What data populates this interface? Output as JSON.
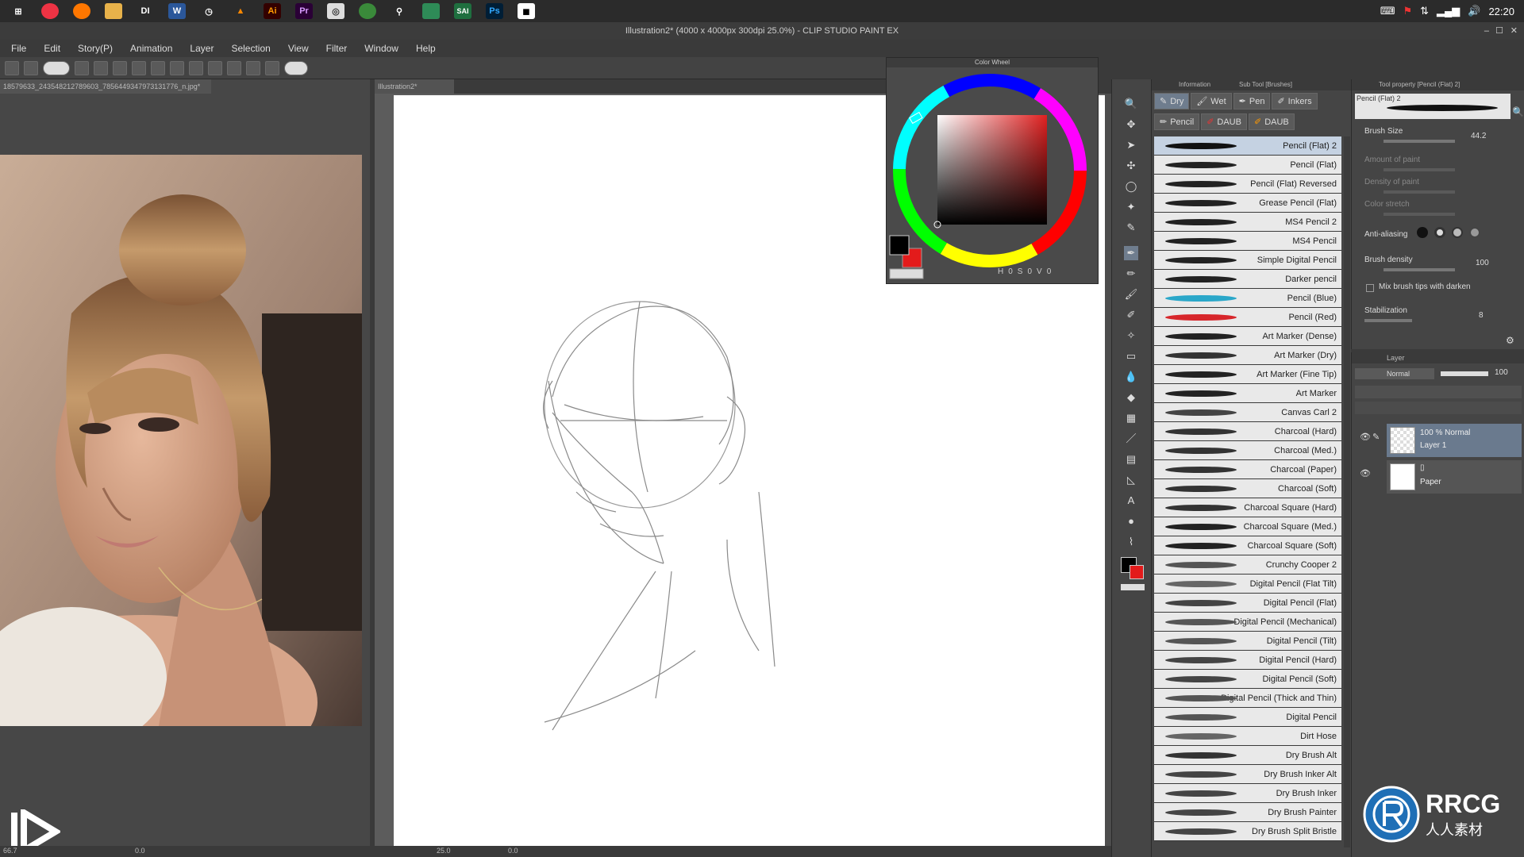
{
  "taskbar": {
    "apps": [
      "DI",
      "W",
      "Ai",
      "Pr",
      "Ps"
    ],
    "clock": "22:20"
  },
  "window": {
    "title": "Illustration2* (4000 x 4000px 300dpi 25.0%)  - CLIP STUDIO PAINT EX"
  },
  "menu": {
    "items": [
      "File",
      "Edit",
      "Story(P)",
      "Animation",
      "Layer",
      "Selection",
      "View",
      "Filter",
      "Window",
      "Help"
    ]
  },
  "reference": {
    "tab_label": "18579633_243548212789603_7856449347973131776_n.jpg*"
  },
  "canvas": {
    "tab_label": "Illustration2*",
    "zoom": "25.0",
    "angle": "0.0",
    "left_zoom": "66.7",
    "left_angle": "0.0"
  },
  "color_wheel": {
    "title": "Color Wheel",
    "h_label": "H",
    "h_value": "0",
    "s_label": "S",
    "s_value": "0",
    "v_label": "V",
    "v_value": "0",
    "main_color": "#000000",
    "sub_color": "#e31b1b"
  },
  "subtool": {
    "title": "Sub Tool [Brushes]",
    "info_tab": "Information",
    "groups": [
      {
        "label": "Dry",
        "active": true
      },
      {
        "label": "Wet",
        "active": false
      },
      {
        "label": "Pen",
        "active": false
      },
      {
        "label": "Inkers",
        "active": false
      }
    ],
    "groups2": [
      {
        "label": "Pencil"
      },
      {
        "label": "DAUB"
      },
      {
        "label": "DAUB"
      }
    ],
    "brushes": [
      {
        "name": "Pencil (Flat) 2",
        "selected": true,
        "color": "#111"
      },
      {
        "name": "Pencil (Flat)",
        "color": "#222"
      },
      {
        "name": "Pencil (Flat) Reversed",
        "color": "#222"
      },
      {
        "name": "Grease Pencil (Flat)",
        "color": "#222"
      },
      {
        "name": "MS4 Pencil 2",
        "color": "#222"
      },
      {
        "name": "MS4 Pencil",
        "color": "#222"
      },
      {
        "name": "Simple Digital Pencil",
        "color": "#222"
      },
      {
        "name": "Darker pencil",
        "color": "#222"
      },
      {
        "name": "Pencil (Blue)",
        "color": "#2aa7c9"
      },
      {
        "name": "Pencil (Red)",
        "color": "#d7262b"
      },
      {
        "name": "Art Marker (Dense)",
        "color": "#222"
      },
      {
        "name": "Art Marker (Dry)",
        "color": "#333"
      },
      {
        "name": "Art Marker (Fine Tip)",
        "color": "#222"
      },
      {
        "name": "Art Marker",
        "color": "#222"
      },
      {
        "name": "Canvas Carl 2",
        "color": "#444"
      },
      {
        "name": "Charcoal (Hard)",
        "color": "#333"
      },
      {
        "name": "Charcoal (Med.)",
        "color": "#333"
      },
      {
        "name": "Charcoal (Paper)",
        "color": "#333"
      },
      {
        "name": "Charcoal (Soft)",
        "color": "#333"
      },
      {
        "name": "Charcoal Square (Hard)",
        "color": "#333"
      },
      {
        "name": "Charcoal Square (Med.)",
        "color": "#222"
      },
      {
        "name": "Charcoal Square (Soft)",
        "color": "#222"
      },
      {
        "name": "Crunchy Cooper 2",
        "color": "#555"
      },
      {
        "name": "Digital Pencil (Flat Tilt)",
        "color": "#666"
      },
      {
        "name": "Digital Pencil (Flat)",
        "color": "#444"
      },
      {
        "name": "Digital Pencil (Mechanical)",
        "color": "#555"
      },
      {
        "name": "Digital Pencil (Tilt)",
        "color": "#555"
      },
      {
        "name": "Digital Pencil (Hard)",
        "color": "#444"
      },
      {
        "name": "Digital Pencil (Soft)",
        "color": "#444"
      },
      {
        "name": "Digital Pencil (Thick and Thin)",
        "color": "#555"
      },
      {
        "name": "Digital Pencil",
        "color": "#555"
      },
      {
        "name": "Dirt Hose",
        "color": "#666"
      },
      {
        "name": "Dry Brush Alt",
        "color": "#333"
      },
      {
        "name": "Dry Brush Inker Alt",
        "color": "#444"
      },
      {
        "name": "Dry Brush Inker",
        "color": "#444"
      },
      {
        "name": "Dry Brush Painter",
        "color": "#444"
      },
      {
        "name": "Dry Brush Split Bristle",
        "color": "#444"
      }
    ]
  },
  "tool_property": {
    "title": "Tool property [Pencil (Flat) 2]",
    "preview_label": "Pencil (Flat) 2",
    "brush_size_label": "Brush Size",
    "brush_size_value": "44.2",
    "amount_of_paint_label": "Amount of paint",
    "density_of_paint_label": "Density of paint",
    "color_stretch_label": "Color stretch",
    "anti_aliasing_label": "Anti-aliasing",
    "brush_density_label": "Brush density",
    "brush_density_value": "100",
    "mix_tips_label": "Mix brush tips with darken",
    "stabilization_label": "Stabilization",
    "stabilization_value": "8"
  },
  "layer_panel": {
    "title": "Layer",
    "blend_mode": "Normal",
    "opacity": "100",
    "layers": [
      {
        "line1": "100 % Normal",
        "line2": "Layer 1",
        "active": true
      },
      {
        "line1": "",
        "line2": "Paper",
        "active": false
      }
    ]
  },
  "watermark": {
    "logo_text": "RRCG",
    "logo_sub": "人人素材"
  }
}
